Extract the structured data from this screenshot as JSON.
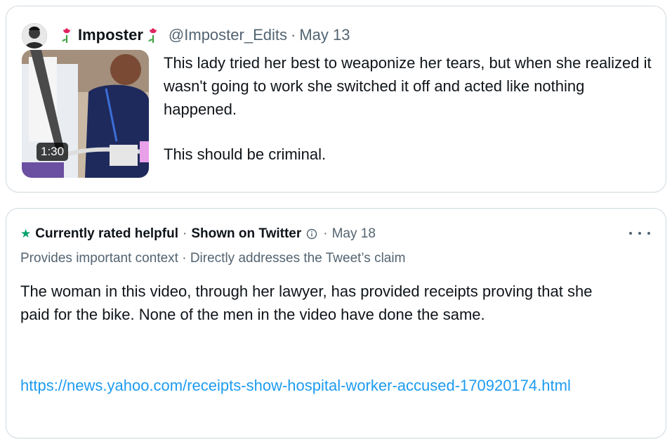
{
  "tweet": {
    "display_name": "Imposter",
    "handle": "@Imposter_Edits",
    "separator": "·",
    "date": "May 13",
    "video_duration": "1:30",
    "text_paragraphs": [
      "This lady tried her best to weaponize her tears, but when she realized it wasn't going to work she switched it off and acted like nothing happened.",
      "This should be criminal."
    ],
    "icons": [
      "avatar",
      "flower-emoji-icon",
      "video-thumbnail"
    ]
  },
  "note": {
    "status": "Currently rated helpful",
    "separator": "·",
    "shown_on": "Shown on Twitter",
    "date": "May 18",
    "tags": "Provides important context · Directly addresses the Tweet’s claim",
    "text": "The woman in this video, through her lawyer, has provided receipts proving that she paid for the bike. None of the men in the video have done the same.",
    "link": "https://news.yahoo.com/receipts-show-hospital-worker-accused-170920174.html",
    "icons": [
      "star-icon",
      "info-icon",
      "more-icon"
    ],
    "accent_color": "#00a36c",
    "link_color": "#1d9bf0"
  }
}
